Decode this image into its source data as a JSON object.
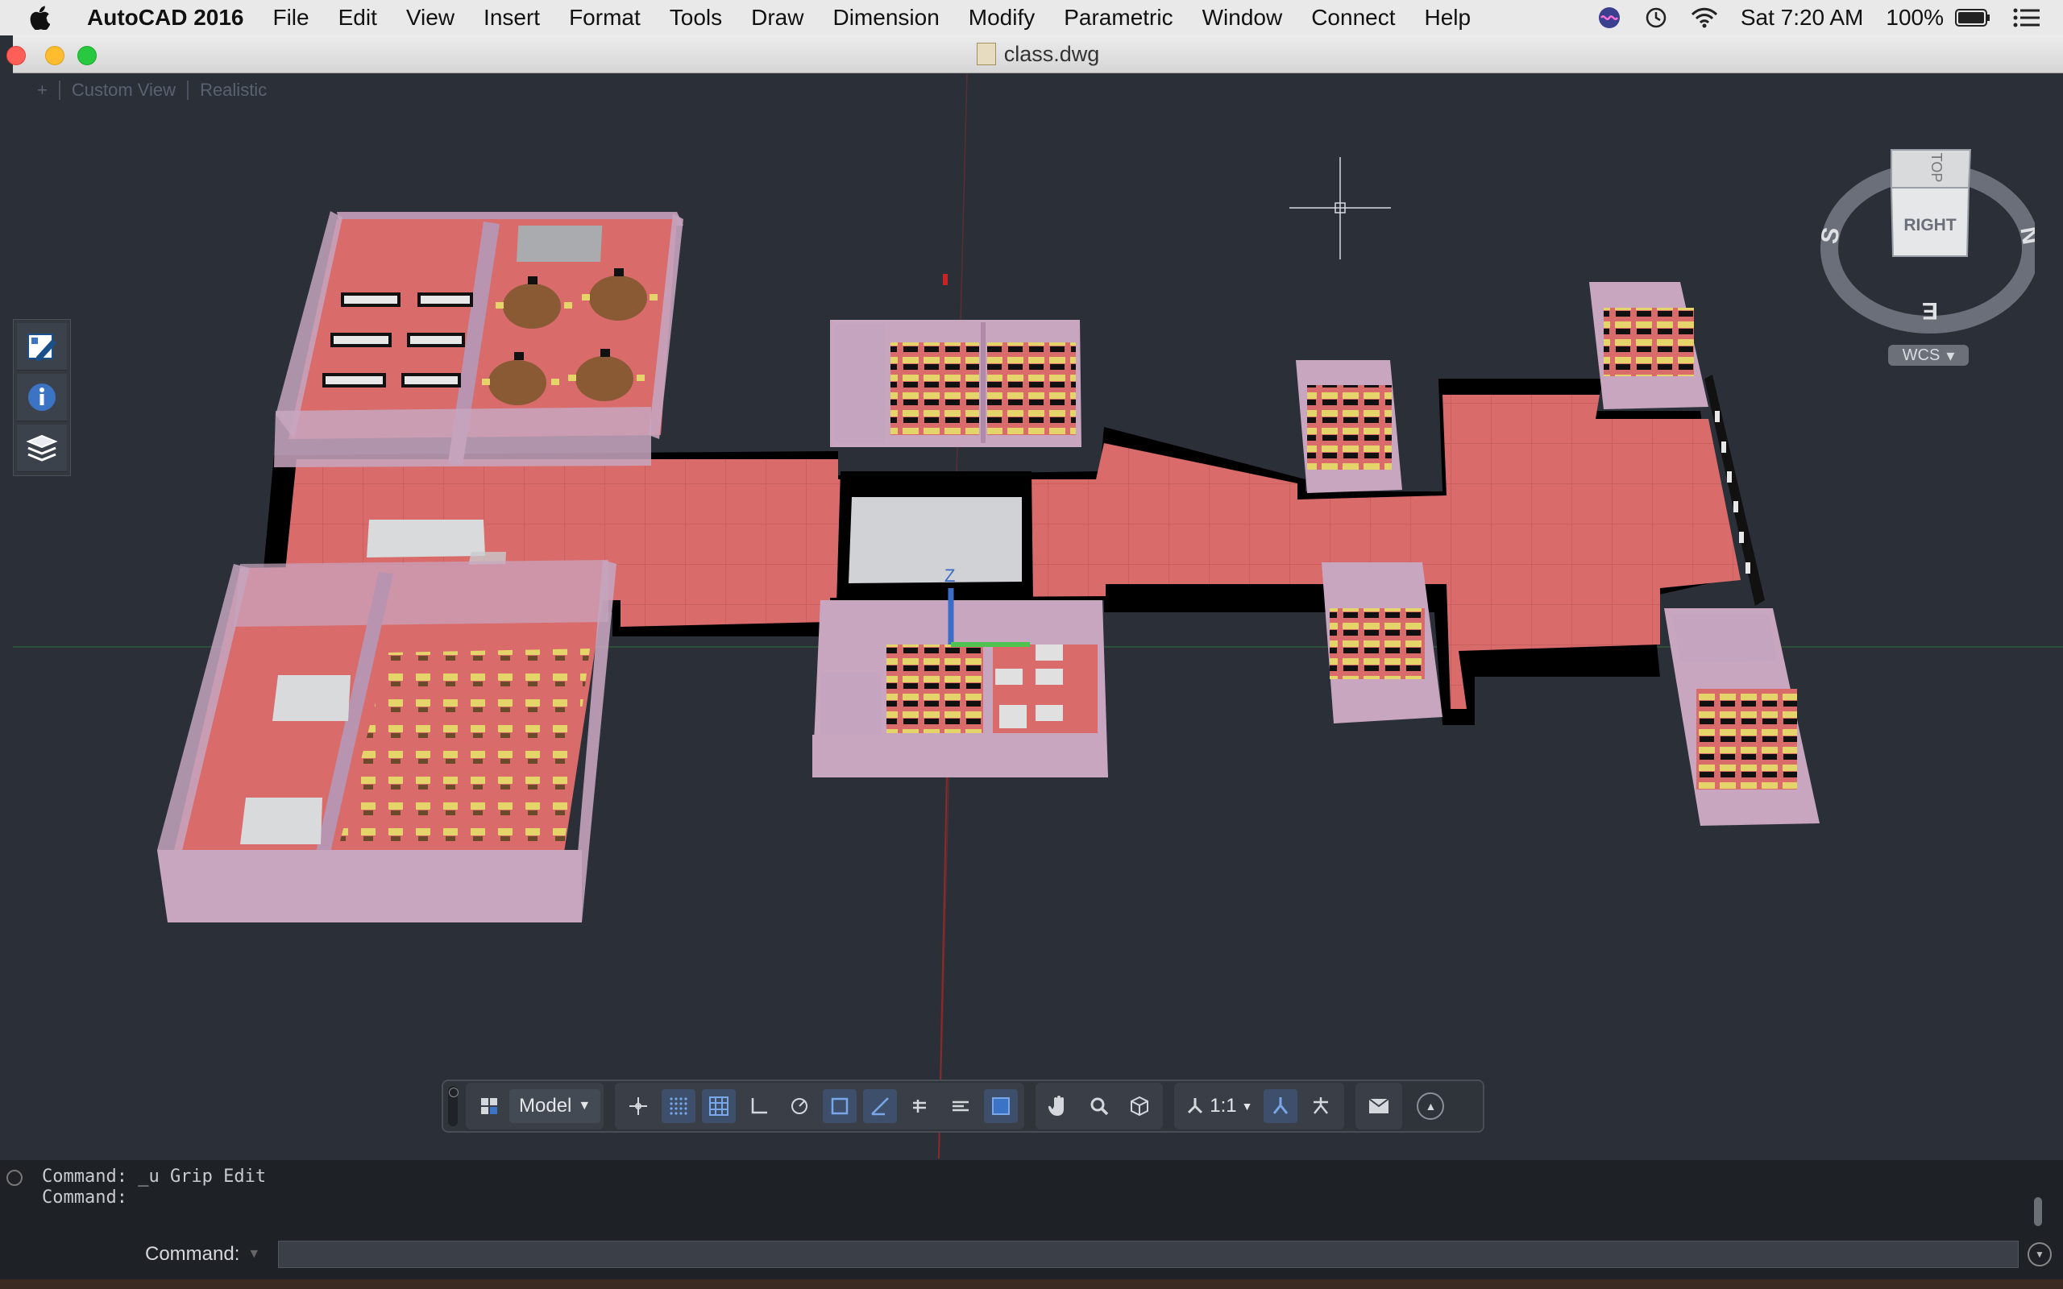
{
  "menubar": {
    "app_name": "AutoCAD 2016",
    "items": [
      "File",
      "Edit",
      "View",
      "Insert",
      "Format",
      "Tools",
      "Draw",
      "Dimension",
      "Modify",
      "Parametric",
      "Window",
      "Connect",
      "Help"
    ],
    "clock": "Sat 7:20 AM",
    "battery": "100%"
  },
  "window": {
    "title": "class.dwg"
  },
  "viewport": {
    "plus": "+",
    "view": "Custom View",
    "style": "Realistic"
  },
  "viewcube": {
    "face_front": "RIGHT",
    "face_top": "TOP",
    "compass_left": "S",
    "compass_right": "N",
    "compass_bottom": "E",
    "ucs": "WCS"
  },
  "statusbar": {
    "model_tab": "Model",
    "annotation_scale": "1:1"
  },
  "command": {
    "history": [
      "Command: _u Grip Edit",
      "Command:"
    ],
    "label": "Command:",
    "input_value": ""
  },
  "colors": {
    "floor": "#d96b6b",
    "wall": "#c8a6c0",
    "viewport_bg": "#2b2f37"
  }
}
